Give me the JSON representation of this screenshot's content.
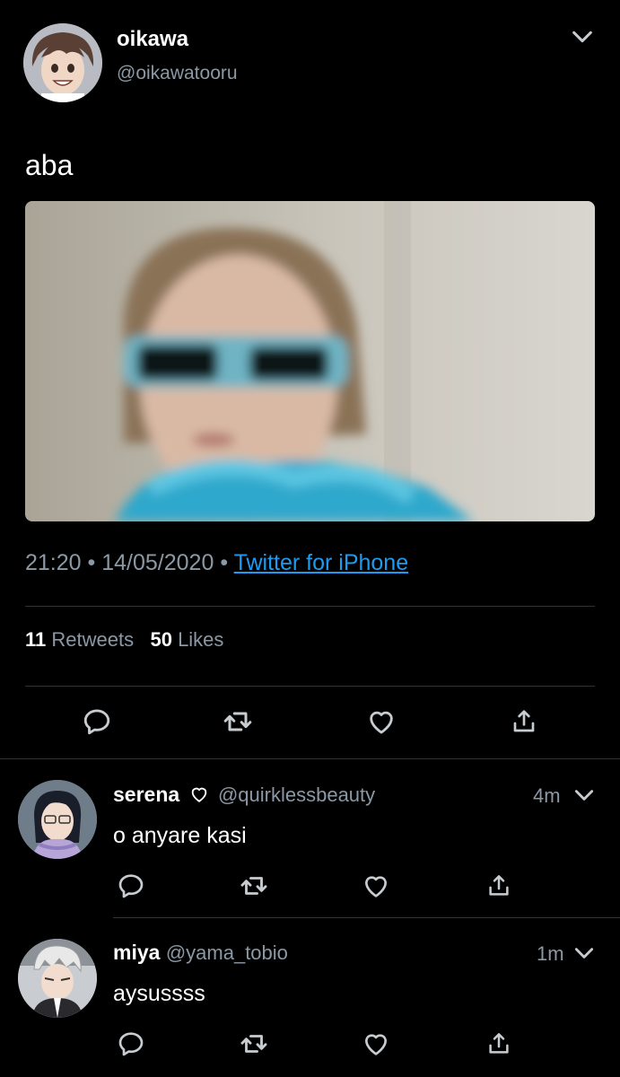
{
  "tweet": {
    "author_name": "oikawa",
    "author_handle": "@oikawatooru",
    "text": "aba",
    "time": "21:20",
    "date": "14/05/2020",
    "source": "Twitter for iPhone",
    "retweets_count": "11",
    "retweets_label": "Retweets",
    "likes_count": "50",
    "likes_label": "Likes",
    "dot": "•"
  },
  "replies": [
    {
      "name": "serena",
      "handle": "@quirklessbeauty",
      "time": "4m",
      "text": "o anyare kasi",
      "badge_icon": "heart-outline-icon"
    },
    {
      "name": "miya",
      "handle": "@yama_tobio",
      "time": "1m",
      "text": "aysussss"
    }
  ],
  "icons": {
    "reply": "comment-bubble-icon",
    "retweet": "retweet-arrows-icon",
    "like": "heart-icon",
    "share": "share-upload-icon",
    "more": "chevron-down-icon"
  },
  "colors": {
    "background": "#000000",
    "secondary_text": "#8b98a5",
    "link": "#1d9bf0",
    "divider": "#2f3336"
  }
}
